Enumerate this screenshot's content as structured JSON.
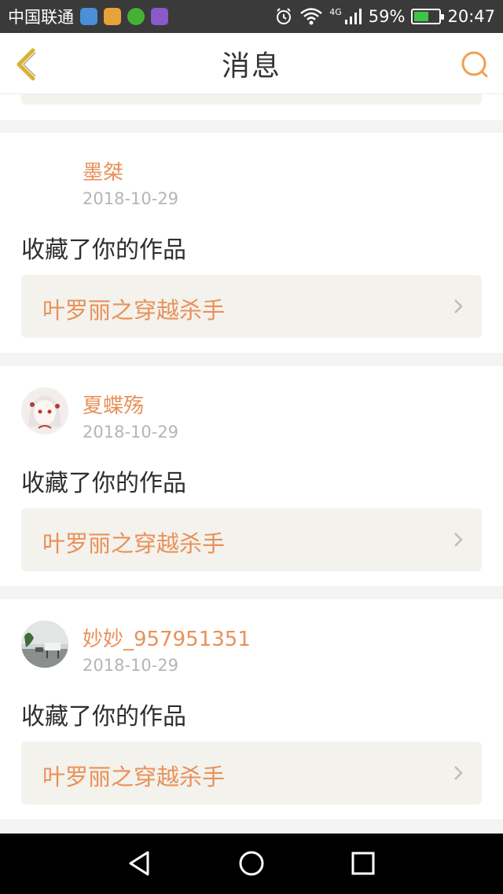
{
  "status_bar": {
    "carrier": "中国联通",
    "network": "4G",
    "battery": "59%",
    "time": "20:47",
    "icons": [
      "location-app-icon",
      "weibo-icon",
      "wechat-icon",
      "gallery-app-icon",
      "alarm-icon",
      "wifi-icon",
      "signal-icon",
      "battery-icon"
    ]
  },
  "header": {
    "title": "消息",
    "back_icon": "chevron-left-icon",
    "search_icon": "search-icon"
  },
  "colors": {
    "accent": "#e8915a",
    "link_bg": "#f4f2ec",
    "back_arrow": "#d9b233",
    "status_bg": "#3a3a3a"
  },
  "messages": [
    {
      "user": "墨桀",
      "date": "2018-10-29",
      "action": "收藏了你的作品",
      "work": "叶罗丽之穿越杀手",
      "avatar": "none"
    },
    {
      "user": "夏蝶殇",
      "date": "2018-10-29",
      "action": "收藏了你的作品",
      "work": "叶罗丽之穿越杀手",
      "avatar": "anime-girl-avatar"
    },
    {
      "user": "妙妙_957951351",
      "date": "2018-10-29",
      "action": "收藏了你的作品",
      "work": "叶罗丽之穿越杀手",
      "avatar": "room-photo-avatar"
    }
  ],
  "nav": {
    "icons": [
      "back-triangle-icon",
      "home-circle-icon",
      "recents-square-icon"
    ]
  }
}
